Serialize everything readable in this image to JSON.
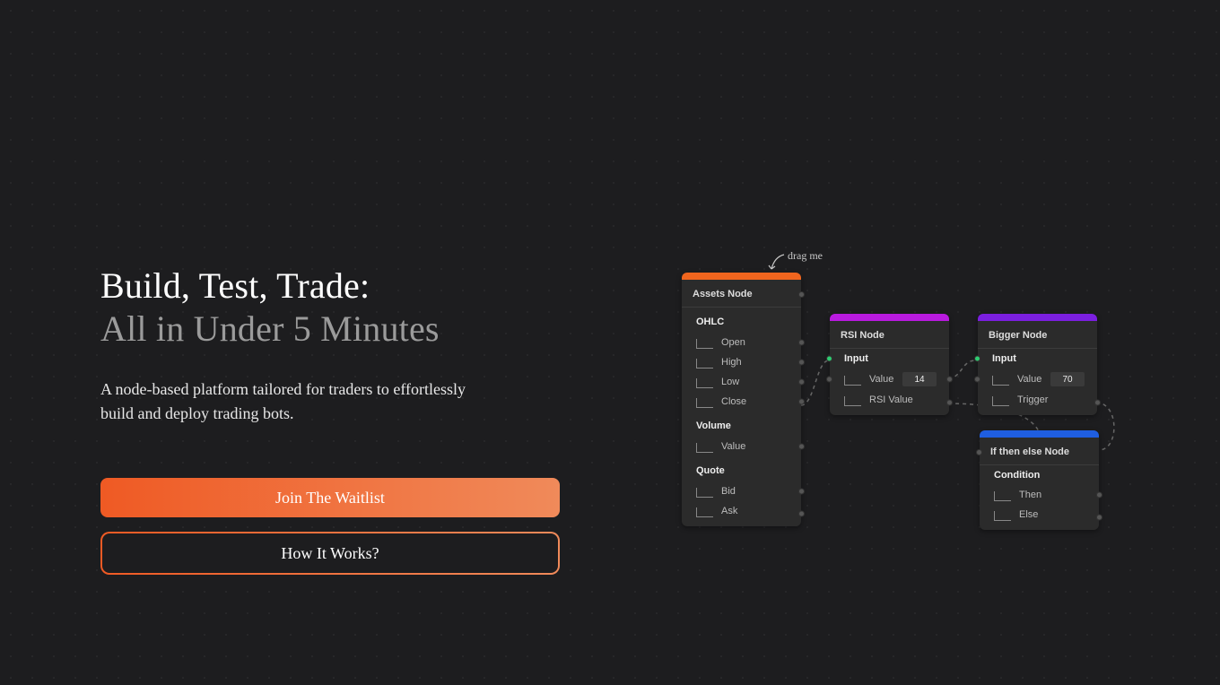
{
  "hero": {
    "title_line1": "Build, Test, Trade:",
    "title_line2": "All in Under 5 Minutes",
    "body": "A node-based platform tailored for traders to effortlessly build and deploy trading bots.",
    "cta_primary": "Join The Waitlist",
    "cta_secondary": "How It Works?"
  },
  "canvas": {
    "drag_hint": "drag me"
  },
  "nodes": {
    "assets": {
      "title": "Assets Node",
      "sections": {
        "ohlc": {
          "label": "OHLC",
          "rows": [
            "Open",
            "High",
            "Low",
            "Close"
          ]
        },
        "volume": {
          "label": "Volume",
          "rows": [
            "Value"
          ]
        },
        "quote": {
          "label": "Quote",
          "rows": [
            "Bid",
            "Ask"
          ]
        }
      }
    },
    "rsi": {
      "title": "RSI Node",
      "input_label": "Input",
      "value_label": "Value",
      "value": "14",
      "output_label": "RSI Value"
    },
    "bigger": {
      "title": "Bigger Node",
      "input_label": "Input",
      "value_label": "Value",
      "value": "70",
      "trigger_label": "Trigger"
    },
    "ifelse": {
      "title": "If then else Node",
      "condition_label": "Condition",
      "then_label": "Then",
      "else_label": "Else"
    }
  }
}
